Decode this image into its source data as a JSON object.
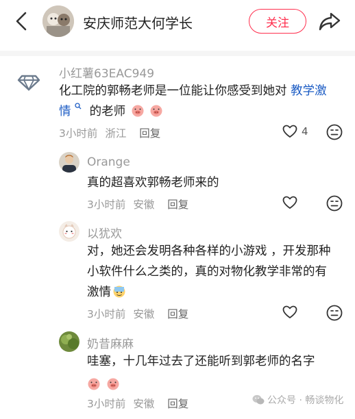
{
  "header": {
    "author_name": "安庆师范大何学长",
    "follow_label": "关注"
  },
  "comments": [
    {
      "username": "小红薯63EAC949",
      "text_line1": "化工院的郭畅老师是一位能让你感受到她对",
      "hashtag_part1": "教学激",
      "hashtag_part2": "情",
      "text_after": "的老师",
      "time": "3小时前",
      "location": "浙江",
      "reply_label": "回复",
      "like_count": "4"
    },
    {
      "username": "Orange",
      "text": "真的超喜欢郭畅老师来的",
      "time": "3小时前",
      "location": "安徽",
      "reply_label": "回复"
    },
    {
      "username": "以犹欢",
      "text_line1": "对，她还会发明各种各样的小游戏 ，开发那种",
      "text_line2": "小软件什么之类的，真的对物化教学非常的有",
      "text_line3": "激情",
      "time": "3小时前",
      "location": "安徽",
      "reply_label": "回复"
    },
    {
      "username": "奶昔麻麻",
      "text": "哇塞，十几年过去了还能听到郭老师的名字",
      "time": "3小时前",
      "location": "安徽",
      "reply_label": "回复"
    }
  ],
  "watermark": {
    "text": "公众号 · 畅谈物化"
  },
  "colors": {
    "accent": "#ff2e4d",
    "hashtag": "#1c5cc4",
    "secondary_text": "#999999"
  },
  "icons": [
    "back-arrow-icon",
    "share-arrow-icon",
    "diamond-avatar-icon",
    "heart-icon",
    "dislike-face-icon",
    "pig-face-emoji-icon",
    "sweat-emoji-icon",
    "wechat-icon"
  ]
}
